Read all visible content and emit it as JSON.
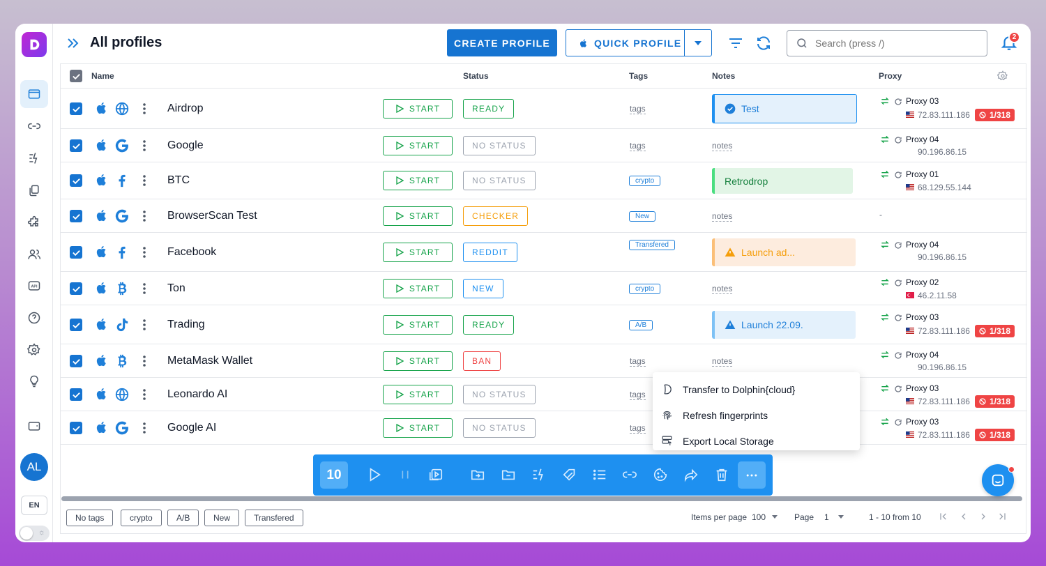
{
  "header": {
    "title": "All profiles",
    "create_label": "CREATE PROFILE",
    "quick_label": "QUICK PROFILE",
    "search_placeholder": "Search (press /)",
    "notifications_count": "2"
  },
  "sidebar": {
    "avatar_initials": "AL",
    "language": "EN"
  },
  "table": {
    "headers": {
      "name": "Name",
      "status": "Status",
      "tags": "Tags",
      "notes": "Notes",
      "proxy": "Proxy"
    },
    "start_label": "START",
    "rows": [
      {
        "name": "Airdrop",
        "site": "globe",
        "status": "READY",
        "tag": "tags",
        "note": "Test",
        "proxy": "Proxy 03",
        "ip": "72.83.111.186",
        "ban": "1/318"
      },
      {
        "name": "Google",
        "site": "google",
        "status": "NO STATUS",
        "tag": "tags",
        "note": "notes",
        "proxy": "Proxy 04",
        "ip": "90.196.86.15"
      },
      {
        "name": "BTC",
        "site": "facebook",
        "status": "NO STATUS",
        "tag": "crypto",
        "note": "Retrodrop",
        "proxy": "Proxy 01",
        "ip": "68.129.55.144"
      },
      {
        "name": "BrowserScan Test",
        "site": "google",
        "status": "CHECKER",
        "tag": "New",
        "note": "notes",
        "proxy": "-"
      },
      {
        "name": "Facebook",
        "site": "facebook",
        "status": "REDDIT",
        "tag": "Transfered",
        "note": "Launch ad...",
        "proxy": "Proxy 04",
        "ip": "90.196.86.15"
      },
      {
        "name": "Ton",
        "site": "bitcoin",
        "status": "NEW",
        "tag": "crypto",
        "note": "notes",
        "proxy": "Proxy 02",
        "ip": "46.2.11.58"
      },
      {
        "name": "Trading",
        "site": "tiktok",
        "status": "READY",
        "tag": "A/B",
        "note": "Launch 22.09.",
        "proxy": "Proxy 03",
        "ip": "72.83.111.186",
        "ban": "1/318"
      },
      {
        "name": "MetaMask Wallet",
        "site": "bitcoin",
        "status": "BAN",
        "tag": "tags",
        "note": "notes",
        "proxy": "Proxy 04",
        "ip": "90.196.86.15"
      },
      {
        "name": "Leonardo AI",
        "site": "globe",
        "status": "NO STATUS",
        "tag": "tags",
        "proxy": "Proxy 03",
        "ip": "72.83.111.186",
        "ban": "1/318"
      },
      {
        "name": "Google AI",
        "site": "google",
        "status": "NO STATUS",
        "tag": "tags",
        "proxy": "Proxy 03",
        "ip": "72.83.111.186",
        "ban": "1/318"
      }
    ]
  },
  "context_menu": {
    "items": [
      "Transfer to Dolphin{cloud}",
      "Refresh fingerprints",
      "Export Local Storage"
    ]
  },
  "toolbar": {
    "selected_count": "10"
  },
  "footer": {
    "filters": [
      "No tags",
      "crypto",
      "A/B",
      "New",
      "Transfered"
    ],
    "items_per_page_label": "Items per page",
    "items_per_page": "100",
    "page_label": "Page",
    "page": "1",
    "range": "1 - 10 from 10"
  },
  "colors": {
    "accent": "#1674d1",
    "ready": "#16a34a",
    "checker": "#f59e0b",
    "info": "#1e90f0",
    "ban": "#ef4444",
    "muted": "#9ca3af"
  }
}
